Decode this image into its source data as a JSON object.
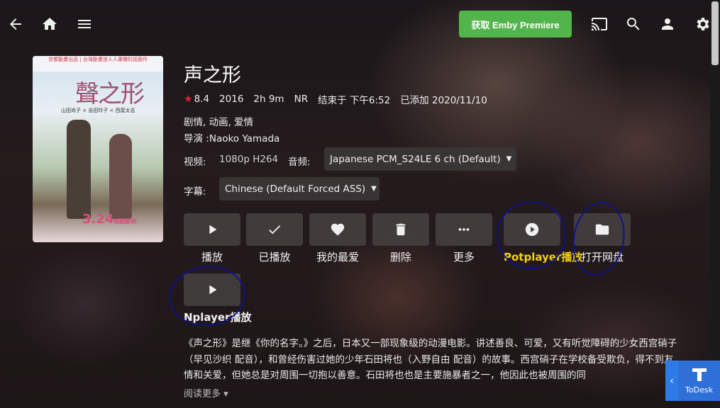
{
  "header": {
    "premiere_label": "获取 Emby Premiere"
  },
  "poster": {
    "banner_line1": "京都動畫出品 | 台灣動畫迷人人專曝的話題作",
    "title": "聲之形",
    "credits": "山田尚子 × 吉田玲子 × 西屋太志",
    "date": "3.24",
    "date_suffix": "感動獻映"
  },
  "item": {
    "title": "声之形",
    "rating": "8.4",
    "year": "2016",
    "runtime": "2h 9m",
    "official_rating": "NR",
    "ends_at": "结束于 下午6:52",
    "added": "已添加 2020/11/10",
    "genres": "剧情, 动画, 爱情",
    "director": "导演 :Naoko Yamada"
  },
  "streams": {
    "video_label": "视频:",
    "video_value": "1080p H264",
    "audio_label": "音频:",
    "audio_value": "Japanese PCM_S24LE 6 ch (Default)",
    "subtitle_label": "字幕:",
    "subtitle_value": "Chinese (Default Forced ASS)"
  },
  "actions": [
    {
      "label": "播放",
      "icon": "play-icon"
    },
    {
      "label": "已播放",
      "icon": "check-icon"
    },
    {
      "label": "我的最爱",
      "icon": "heart-icon"
    },
    {
      "label": "删除",
      "icon": "trash-icon"
    },
    {
      "label": "更多",
      "icon": "more-icon"
    },
    {
      "label": "Potplayer播放",
      "icon": "play-circle-icon"
    },
    {
      "label": "打开网盘",
      "icon": "folder-icon"
    },
    {
      "label": "Nplayer播放",
      "icon": "play-icon"
    }
  ],
  "overview": {
    "text": "《声之形》是继《你的名字。》之后，日本又一部现象级的动漫电影。讲述善良、可爱，又有听觉障碍的少女西宫硝子（早见沙织 配音），和曾经伤害过她的少年石田将也（入野自由 配音）的故事。西宫硝子在学校备受欺负，得不到友情和关爱，但她总是对周围一切抱以善意。石田将也也是主要施暴者之一，他因此也被周围的同",
    "read_more": "阅读更多 ▾"
  },
  "todesk": {
    "label": "ToDesk",
    "collapse": "‹"
  },
  "colors": {
    "premiere_green": "#52b54b",
    "potplayer_label": "#f3d21a",
    "annotation_circle": "#10128a",
    "todesk_blue": "#2f6fd8"
  }
}
